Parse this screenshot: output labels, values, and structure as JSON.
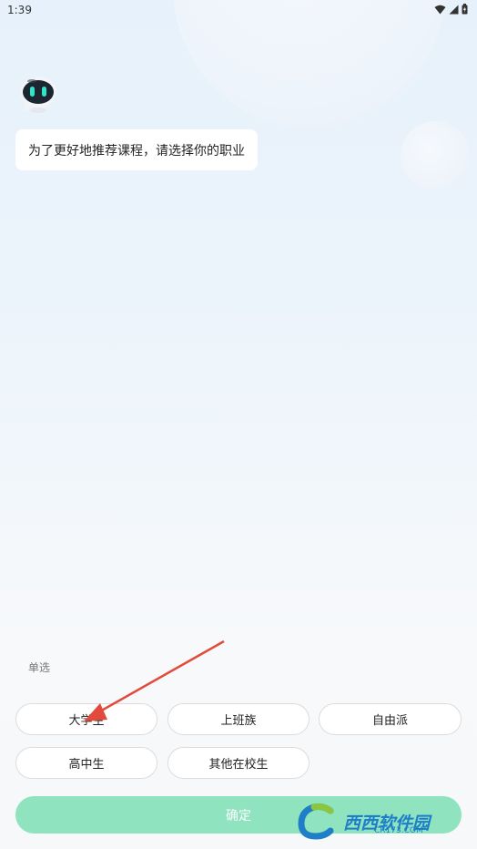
{
  "status_bar": {
    "time": "1:39",
    "icons": [
      "wifi-icon",
      "signal-icon",
      "battery-icon"
    ]
  },
  "chat": {
    "message": "为了更好地推荐课程，请选择你的职业"
  },
  "selection": {
    "mode_label": "单选",
    "options": [
      "大学生",
      "上班族",
      "自由派",
      "高中生",
      "其他在校生"
    ]
  },
  "confirm_button": {
    "label": "确定"
  },
  "watermark": {
    "logo_text": "西西软件园",
    "url_text": "CR173.COM"
  },
  "colors": {
    "confirm_bg": "#8fe3bf",
    "arrow": "#e24b3b",
    "robot_eye": "#31e6c8"
  }
}
